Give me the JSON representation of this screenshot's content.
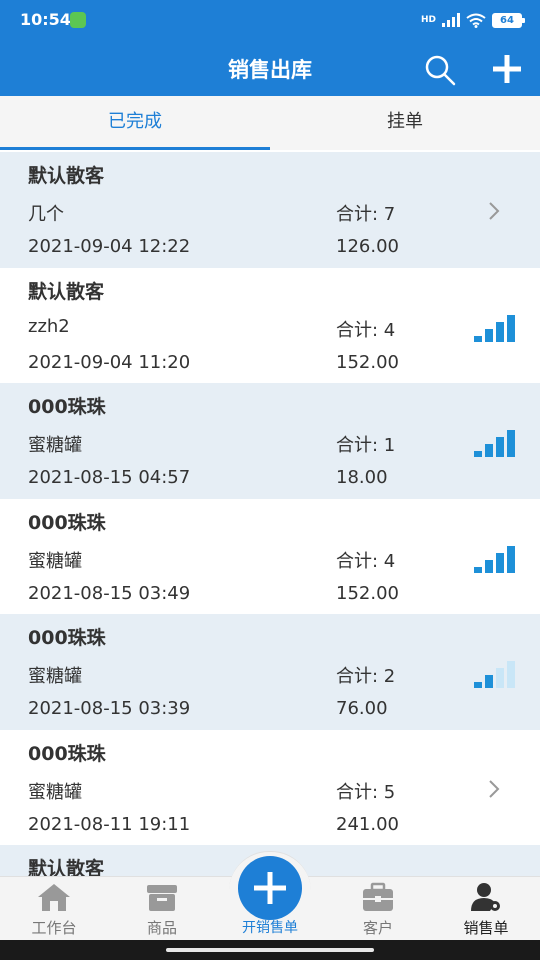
{
  "status_bar": {
    "time": "10:54",
    "network": "HD",
    "battery": "64"
  },
  "header": {
    "title": "销售出库",
    "search_icon": "search-icon",
    "add_icon": "plus-icon"
  },
  "tabs": [
    {
      "label": "已完成",
      "active": true
    },
    {
      "label": "挂单",
      "active": false
    }
  ],
  "orders": [
    {
      "customer": "默认散客",
      "product": "几个",
      "total": "合计: 7",
      "date": "2021-09-04 12:22",
      "amount": "126.00",
      "indicator": "chevron",
      "signal_level": 0
    },
    {
      "customer": "默认散客",
      "product": "zzh2",
      "total": "合计: 4",
      "date": "2021-09-04 11:20",
      "amount": "152.00",
      "indicator": "signal",
      "signal_level": 4
    },
    {
      "customer": "000珠珠",
      "product": "蜜糖罐",
      "total": "合计: 1",
      "date": "2021-08-15 04:57",
      "amount": "18.00",
      "indicator": "signal",
      "signal_level": 4
    },
    {
      "customer": "000珠珠",
      "product": "蜜糖罐",
      "total": "合计: 4",
      "date": "2021-08-15 03:49",
      "amount": "152.00",
      "indicator": "signal",
      "signal_level": 4
    },
    {
      "customer": "000珠珠",
      "product": "蜜糖罐",
      "total": "合计: 2",
      "date": "2021-08-15 03:39",
      "amount": "76.00",
      "indicator": "signal",
      "signal_level": 2
    },
    {
      "customer": "000珠珠",
      "product": "蜜糖罐",
      "total": "合计: 5",
      "date": "2021-08-11 19:11",
      "amount": "241.00",
      "indicator": "chevron",
      "signal_level": 0
    },
    {
      "customer": "默认散客",
      "product": "",
      "total": "",
      "date": "",
      "amount": "",
      "indicator": "none",
      "signal_level": 0
    }
  ],
  "bottom_nav": [
    {
      "label": "工作台",
      "icon": "home-icon"
    },
    {
      "label": "商品",
      "icon": "box-icon"
    },
    {
      "label": "开销售单",
      "icon": "plus-circle-icon"
    },
    {
      "label": "客户",
      "icon": "briefcase-icon"
    },
    {
      "label": "销售单",
      "icon": "user-gear-icon",
      "current": true
    }
  ],
  "colors": {
    "primary": "#1e7fd6",
    "row_shade": "#e6eef5",
    "signal_on": "#1e90d8",
    "signal_off": "#c9e6f7"
  }
}
